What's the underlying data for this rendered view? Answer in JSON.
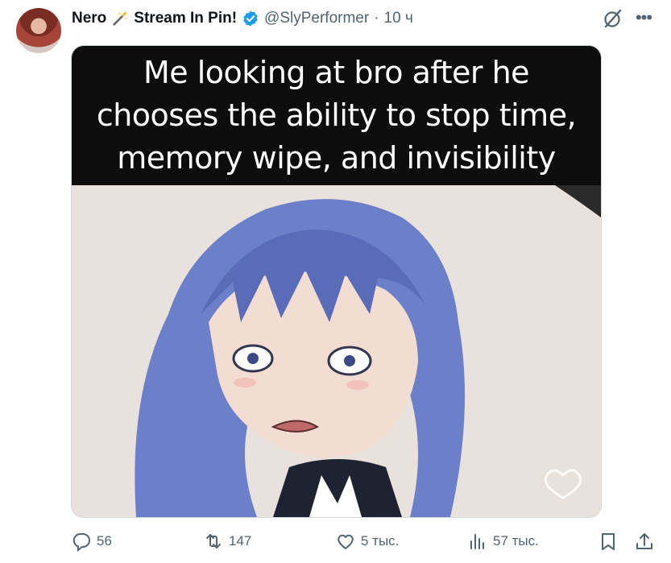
{
  "tweet": {
    "author": {
      "name": "Nero",
      "name_suffix": "Stream In Pin!",
      "handle": "@SlyPerformer",
      "separator": "·",
      "time": "10 ч"
    },
    "media": {
      "caption": "Me looking at bro after he chooses the ability to stop time, memory wipe, and invisibility"
    },
    "actions": {
      "replies": "56",
      "reposts": "147",
      "likes": "5 тыс.",
      "views": "57 тыс."
    }
  },
  "colors": {
    "secondary_text": "#536471",
    "verified": "#1d9bf0",
    "caption_bg": "#0d0d0d",
    "hair": "#6c7fc9"
  }
}
